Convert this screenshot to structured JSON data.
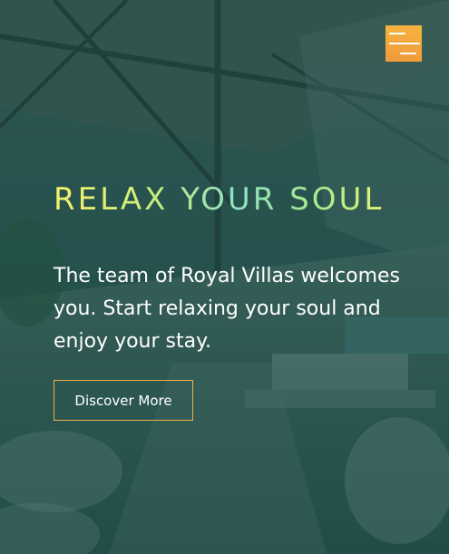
{
  "header": {
    "menu_icon": "hamburger-menu-icon"
  },
  "hero": {
    "tagline": "RELAX YOUR SOUL",
    "intro": "The team of Royal Villas welcomes you. Start relaxing your soul and enjoy your stay.",
    "cta_label": "Discover More"
  },
  "colors": {
    "overlay": "#0a4644",
    "menu_button": "#f4a93e",
    "cta_border": "#e9b24a",
    "tagline_start": "#f7f06a",
    "tagline_mid": "#8fe0c4",
    "text": "#ffffff"
  }
}
